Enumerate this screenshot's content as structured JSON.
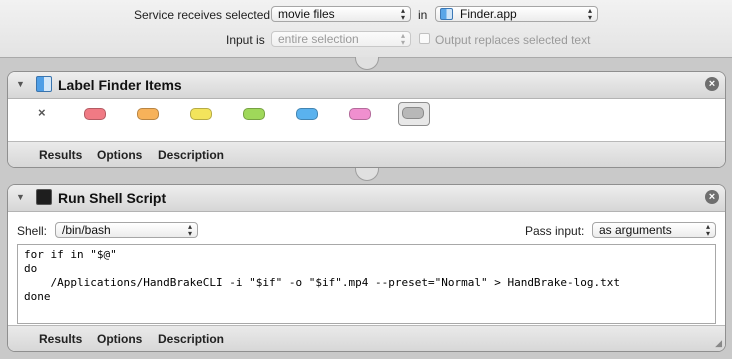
{
  "service": {
    "receives_label": "Service receives selected",
    "receives_value": "movie files",
    "in_label": "in",
    "app_value": "Finder.app",
    "input_label": "Input is",
    "input_value": "entire selection",
    "replaces_label": "Output replaces selected text"
  },
  "label_action": {
    "title": "Label Finder Items",
    "none_symbol": "×",
    "colors": [
      "#f07a84",
      "#f7b25a",
      "#f3e45c",
      "#9fd85a",
      "#5ab2ee",
      "#f08fcf",
      "#b8b8b8"
    ],
    "tabs": [
      "Results",
      "Options",
      "Description"
    ]
  },
  "shell_action": {
    "title": "Run Shell Script",
    "shell_label": "Shell:",
    "shell_value": "/bin/bash",
    "pass_label": "Pass input:",
    "pass_value": "as arguments",
    "script": "for if in \"$@\"\ndo\n    /Applications/HandBrakeCLI -i \"$if\" -o \"$if\".mp4 --preset=\"Normal\" > HandBrake-log.txt\ndone",
    "tabs": [
      "Results",
      "Options",
      "Description"
    ]
  },
  "icons": {
    "popup_arrow": "updown-arrow-icon",
    "close": "close-icon",
    "disclosure": "disclosure-triangle-icon",
    "resize": "resize-grip-icon"
  }
}
